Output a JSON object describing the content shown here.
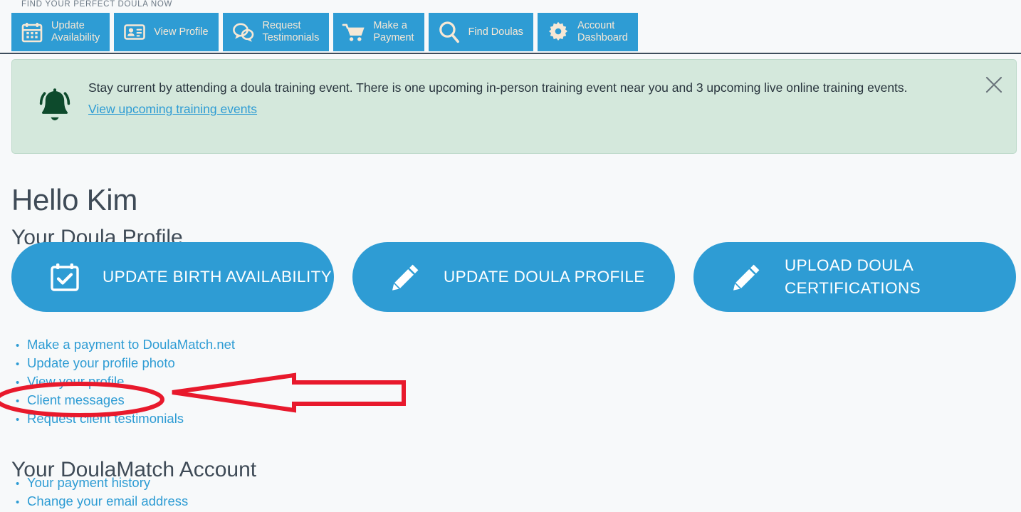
{
  "tagline": "FIND YOUR PERFECT DOULA NOW",
  "colors": {
    "brand_blue": "#2e9cd4",
    "nav_icon_cream": "#f7e8d5",
    "banner_bg": "#d4e8dc",
    "banner_bell": "#0d4a2c",
    "annotation_red": "#e8192c",
    "page_bg": "#f7f9fa"
  },
  "topnav": {
    "items": [
      {
        "label": "Update\nAvailability",
        "icon": "calendar-icon"
      },
      {
        "label": "View Profile",
        "icon": "id-card-icon"
      },
      {
        "label": "Request\nTestimonials",
        "icon": "speech-bubbles-icon"
      },
      {
        "label": "Make a\nPayment",
        "icon": "shopping-cart-icon"
      },
      {
        "label": "Find Doulas",
        "icon": "search-icon"
      },
      {
        "label": "Account\nDashboard",
        "icon": "gear-icon"
      }
    ]
  },
  "banner": {
    "icon": "bell-icon",
    "message": "Stay current by attending a doula training event. There is one upcoming in-person training event near you and 3 upcoming live online training events.",
    "link_label": "View upcoming training events",
    "close_label": "✕"
  },
  "main": {
    "greeting": "Hello Kim",
    "profile_section_title": "Your Doula Profile",
    "account_section_title": "Your DoulaMatch Account",
    "cta_buttons": [
      {
        "label": "UPDATE BIRTH AVAILABILITY",
        "icon": "calendar-check-icon"
      },
      {
        "label": "UPDATE DOULA PROFILE",
        "icon": "pencil-icon"
      },
      {
        "label": "UPLOAD DOULA\nCERTIFICATIONS",
        "icon": "pencil-icon"
      }
    ],
    "profile_links": [
      "Make a payment to DoulaMatch.net",
      "Update your profile photo",
      "View your profile",
      "Client messages",
      "Request client testimonials"
    ],
    "account_links": [
      "Your payment history",
      "Change your email address"
    ]
  },
  "annotations": {
    "ellipse_target": "Client messages",
    "arrow_direction": "left"
  }
}
